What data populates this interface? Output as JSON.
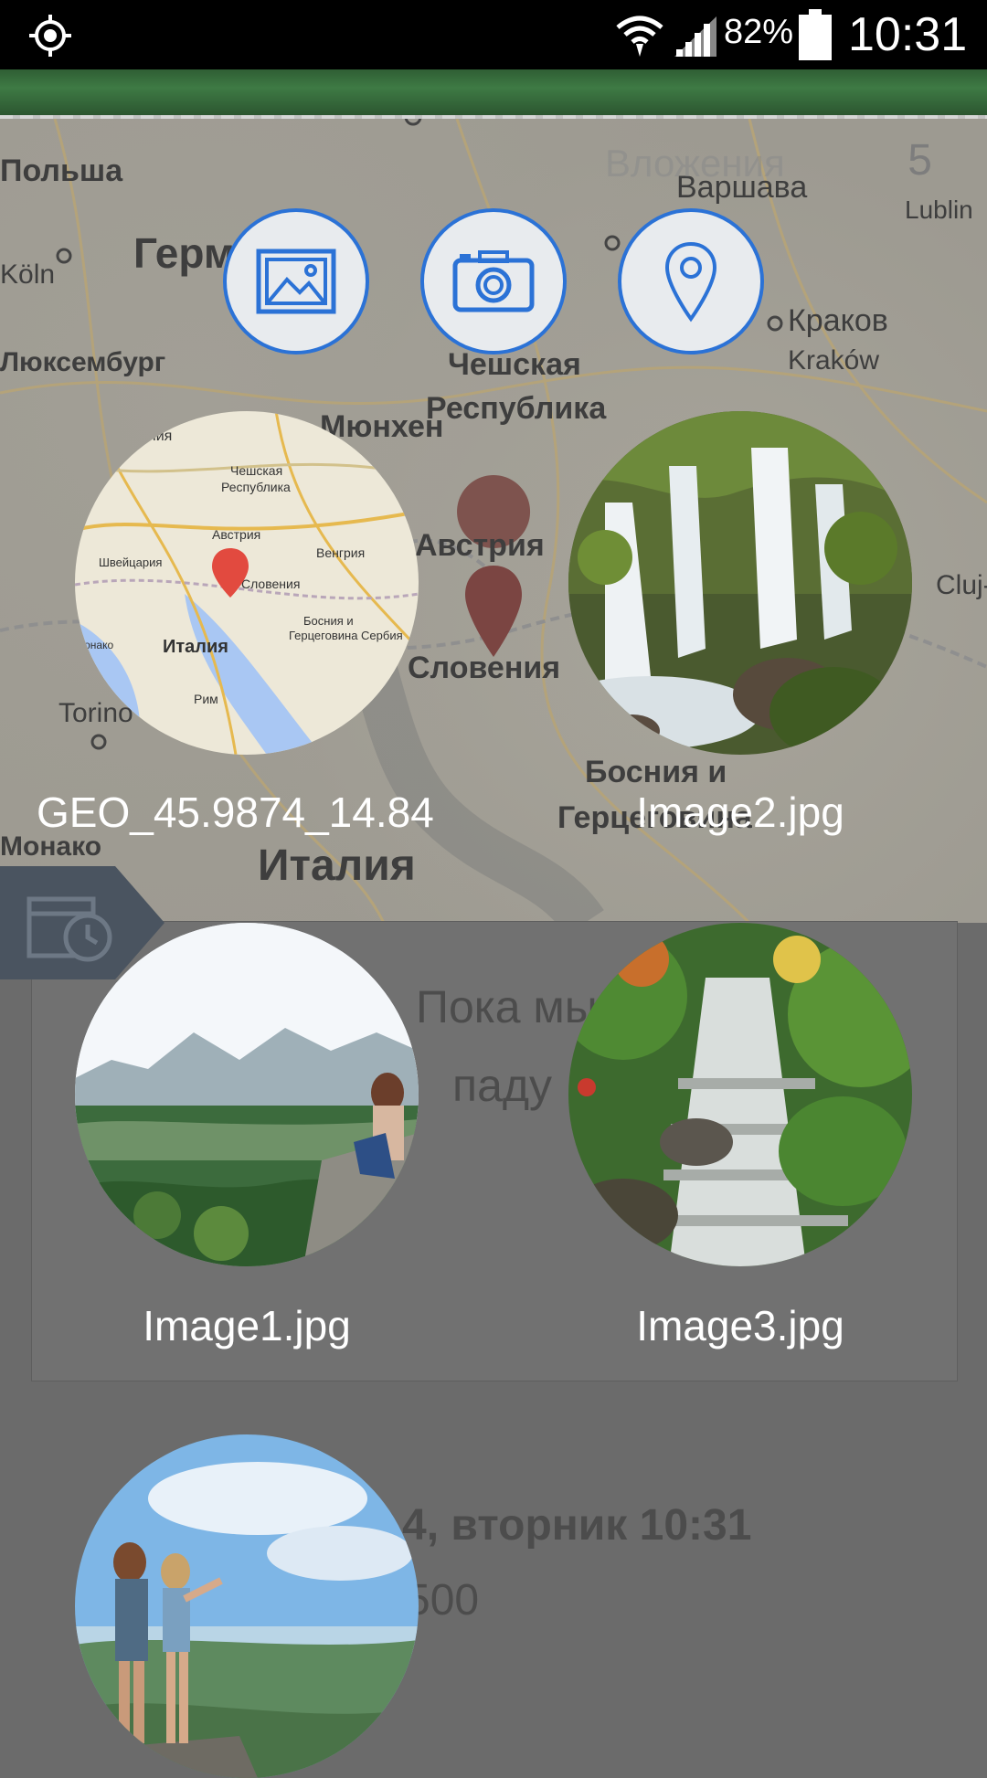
{
  "status_bar": {
    "battery_percent": "82%",
    "time": "10:31"
  },
  "background": {
    "attachments_title": "Вложения",
    "attachments_count": "5",
    "map_labels": [
      "Варшава",
      "Германия",
      "Чешская",
      "Республика",
      "Краков",
      "Kraków",
      "Австрия",
      "Словения",
      "Босния и",
      "Герцеговина",
      "Италия",
      "Монако",
      "Torino",
      "Cluj-Na",
      "Lublin",
      "Köln",
      "Мюнхен",
      "Люксембург",
      "Польша"
    ],
    "card_text_line1": "Пока мы с",
    "card_text_line2": "паду",
    "date_text": "4, вторник 10:31",
    "amount_text": "500"
  },
  "actions": {
    "gallery": "gallery-icon",
    "camera": "camera-icon",
    "location": "location-pin-icon"
  },
  "attachments": [
    {
      "label": "GEO_45.9874_14.84",
      "kind": "map"
    },
    {
      "label": "Image2.jpg",
      "kind": "waterfall"
    },
    {
      "label": "Image1.jpg",
      "kind": "mountain-view"
    },
    {
      "label": "Image3.jpg",
      "kind": "cascade"
    },
    {
      "label": "",
      "kind": "couple-view"
    }
  ],
  "colors": {
    "accent_blue": "#2b72d6",
    "button_fill": "#e8ebee",
    "header_green": "#3e7a44",
    "overlay_dim": "#6b6b6b"
  }
}
